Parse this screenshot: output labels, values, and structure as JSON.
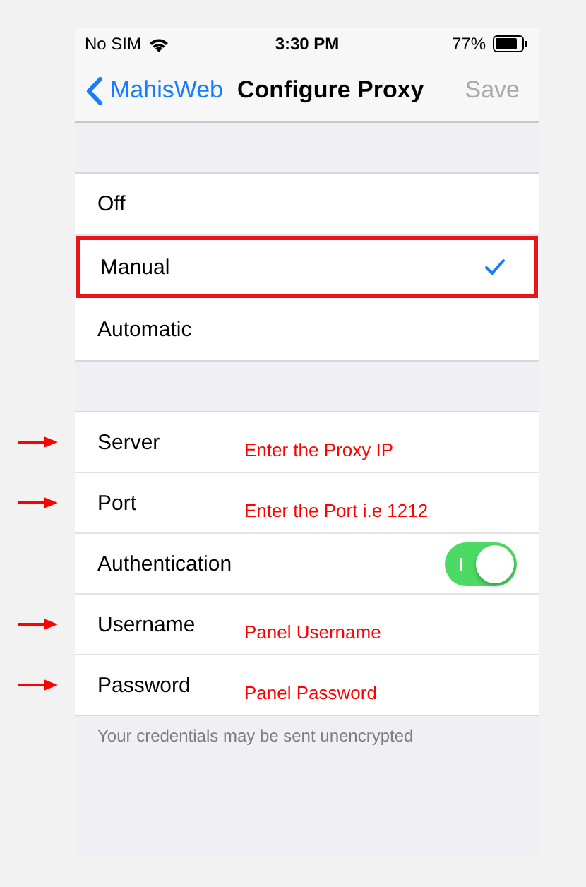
{
  "status_bar": {
    "carrier": "No SIM",
    "time": "3:30 PM",
    "battery": "77%"
  },
  "nav": {
    "back": "MahisWeb",
    "title": "Configure Proxy",
    "action": "Save",
    "action_disabled": true
  },
  "modes": [
    {
      "label": "Off",
      "selected": false,
      "highlighted": false
    },
    {
      "label": "Manual",
      "selected": true,
      "highlighted": true
    },
    {
      "label": "Automatic",
      "selected": false,
      "highlighted": false
    }
  ],
  "settings": [
    {
      "kind": "field",
      "label": "Server",
      "annotation": "Enter the Proxy IP",
      "arrow": true
    },
    {
      "kind": "field",
      "label": "Port",
      "annotation": "Enter the Port i.e 1212",
      "arrow": true
    },
    {
      "kind": "toggle",
      "label": "Authentication",
      "on": true
    },
    {
      "kind": "field",
      "label": "Username",
      "annotation": "Panel Username",
      "arrow": true
    },
    {
      "kind": "field",
      "label": "Password",
      "annotation": "Panel Password",
      "arrow": true
    }
  ],
  "footer": "Your credentials may be sent unencrypted"
}
